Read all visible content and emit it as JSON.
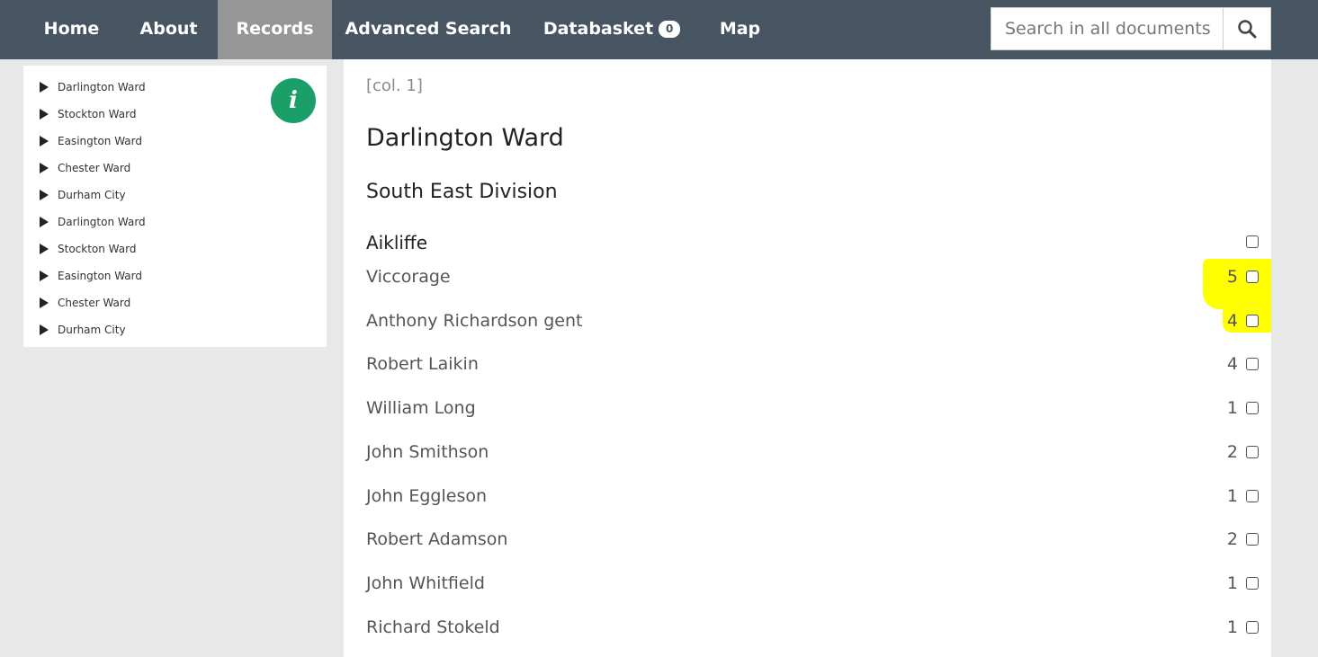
{
  "nav": {
    "items": [
      "Home",
      "About",
      "Records",
      "Advanced Search",
      "Databasket",
      "Map"
    ],
    "databasket_count": "0",
    "active": "Records"
  },
  "search": {
    "placeholder": "Search in all documents"
  },
  "sidebar": {
    "tree": [
      "Darlington Ward",
      "Stockton Ward",
      "Easington Ward",
      "Chester Ward",
      "Durham City",
      "Darlington Ward",
      "Stockton Ward",
      "Easington Ward",
      "Chester Ward",
      "Durham City"
    ],
    "info_label": "i"
  },
  "content": {
    "col": "[col. 1]",
    "ward": "Darlington Ward",
    "division": "South East Division",
    "place": "Aikliffe",
    "rows": [
      {
        "name": "Viccorage",
        "count": "5",
        "highlighted": true
      },
      {
        "name": "Anthony Richardson gent",
        "count": "4",
        "highlighted": true
      },
      {
        "name": "Robert Laikin",
        "count": "4",
        "highlighted": false
      },
      {
        "name": "William Long",
        "count": "1",
        "highlighted": false
      },
      {
        "name": "John Smithson",
        "count": "2",
        "highlighted": false
      },
      {
        "name": "John Eggleson",
        "count": "1",
        "highlighted": false
      },
      {
        "name": "Robert Adamson",
        "count": "2",
        "highlighted": false
      },
      {
        "name": "John Whitfield",
        "count": "1",
        "highlighted": false
      },
      {
        "name": "Richard Stokeld",
        "count": "1",
        "highlighted": false
      }
    ]
  },
  "colors": {
    "navbar": "#465561",
    "active_tab": "#969696",
    "info": "#1a9f68",
    "highlight": "#ffff00"
  }
}
